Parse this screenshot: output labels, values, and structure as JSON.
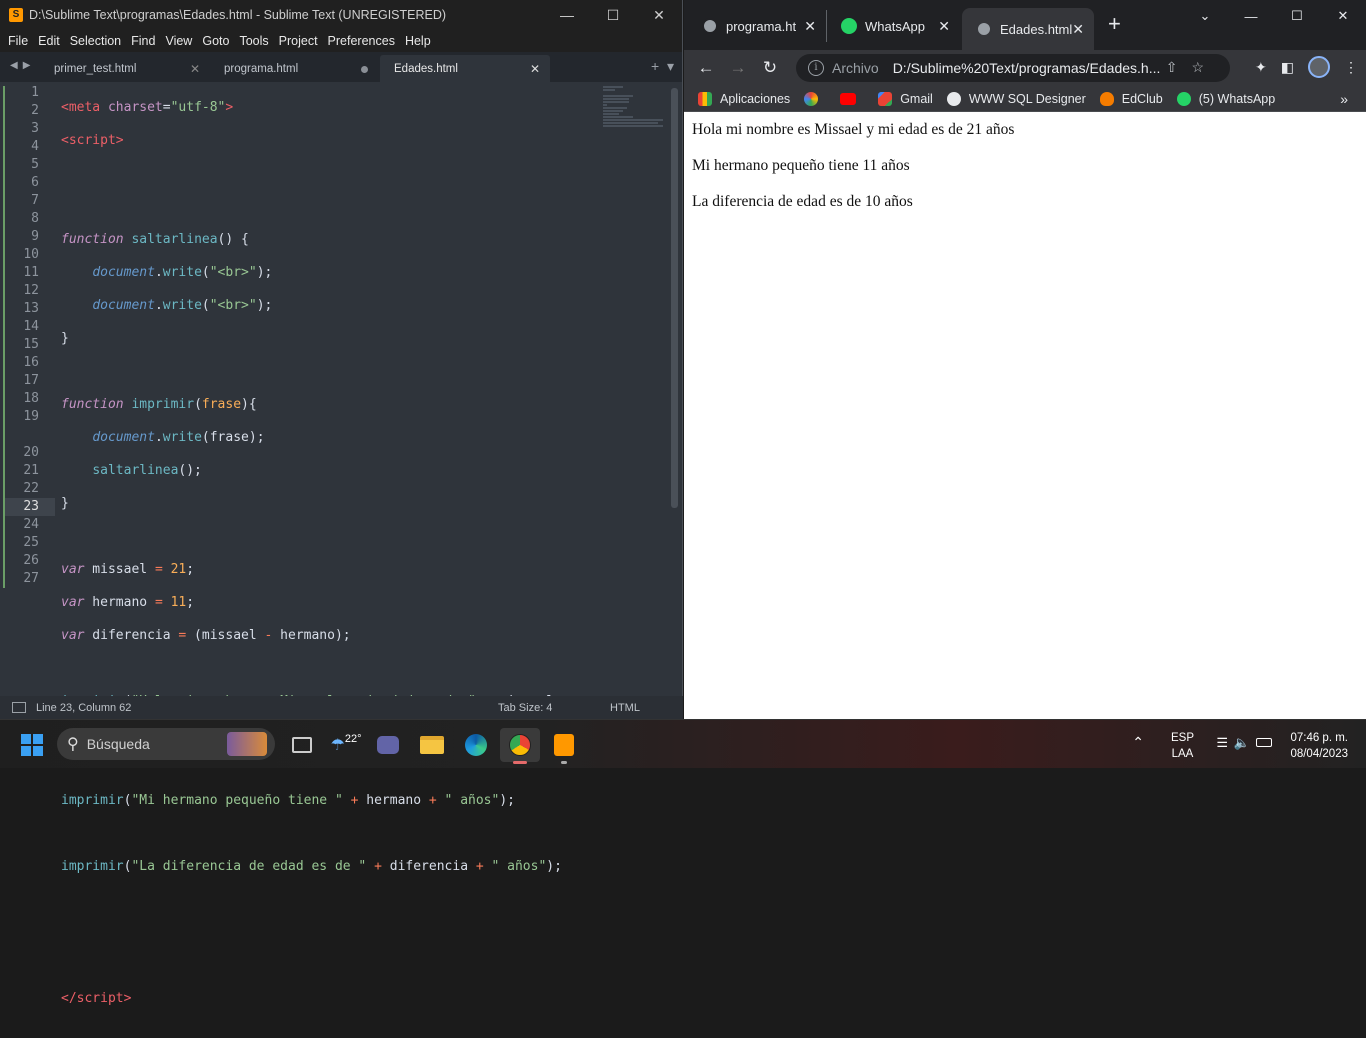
{
  "sublime": {
    "title": "D:\\Sublime Text\\programas\\Edades.html - Sublime Text (UNREGISTERED)",
    "menu": [
      "File",
      "Edit",
      "Selection",
      "Find",
      "View",
      "Goto",
      "Tools",
      "Project",
      "Preferences",
      "Help"
    ],
    "tabs": [
      {
        "label": "primer_test.html",
        "state": "close"
      },
      {
        "label": "programa.html",
        "state": "modified"
      },
      {
        "label": "Edades.html",
        "state": "active"
      }
    ],
    "line_numbers": [
      "1",
      "2",
      "3",
      "4",
      "5",
      "6",
      "7",
      "8",
      "9",
      "10",
      "11",
      "12",
      "13",
      "14",
      "15",
      "16",
      "17",
      "18",
      "19",
      "",
      "20",
      "21",
      "22",
      "23",
      "24",
      "25",
      "26",
      "27"
    ],
    "current_line": "23",
    "status": {
      "position": "Line 23, Column 62",
      "tab_size": "Tab Size: 4",
      "syntax": "HTML"
    }
  },
  "browser": {
    "tabs": [
      {
        "label": "programa.htm",
        "icon": "globe-icon"
      },
      {
        "label": "WhatsApp",
        "icon": "whatsapp-icon"
      },
      {
        "label": "Edades.html",
        "icon": "globe-icon",
        "active": true
      }
    ],
    "address": {
      "scheme": "Archivo",
      "url": "D:/Sublime%20Text/programas/Edades.h..."
    },
    "bookmarks": [
      {
        "label": "Aplicaciones",
        "icon": "apps-grid-icon",
        "color": "#ea4335"
      },
      {
        "label": "",
        "icon": "pinwheel-icon",
        "color": "#fbbc05"
      },
      {
        "label": "",
        "icon": "youtube-icon",
        "color": "#ff0000"
      },
      {
        "label": "Gmail",
        "icon": "gmail-icon",
        "color": "#ea4335"
      },
      {
        "label": "WWW SQL Designer",
        "icon": "globe-icon",
        "color": "#9aa0a6"
      },
      {
        "label": "EdClub",
        "icon": "edclub-icon",
        "color": "#f57c00"
      },
      {
        "label": "(5) WhatsApp",
        "icon": "whatsapp-icon",
        "color": "#25d366"
      }
    ],
    "page_lines": [
      "Hola mi nombre es Missael y mi edad es de 21 años",
      "Mi hermano pequeño tiene 11 años",
      "La diferencia de edad es de 10 años"
    ]
  },
  "taskbar": {
    "search_placeholder": "Búsqueda",
    "weather": "22°",
    "lang_top": "ESP",
    "lang_bottom": "LAA",
    "time": "07:46 p. m.",
    "date": "08/04/2023"
  }
}
